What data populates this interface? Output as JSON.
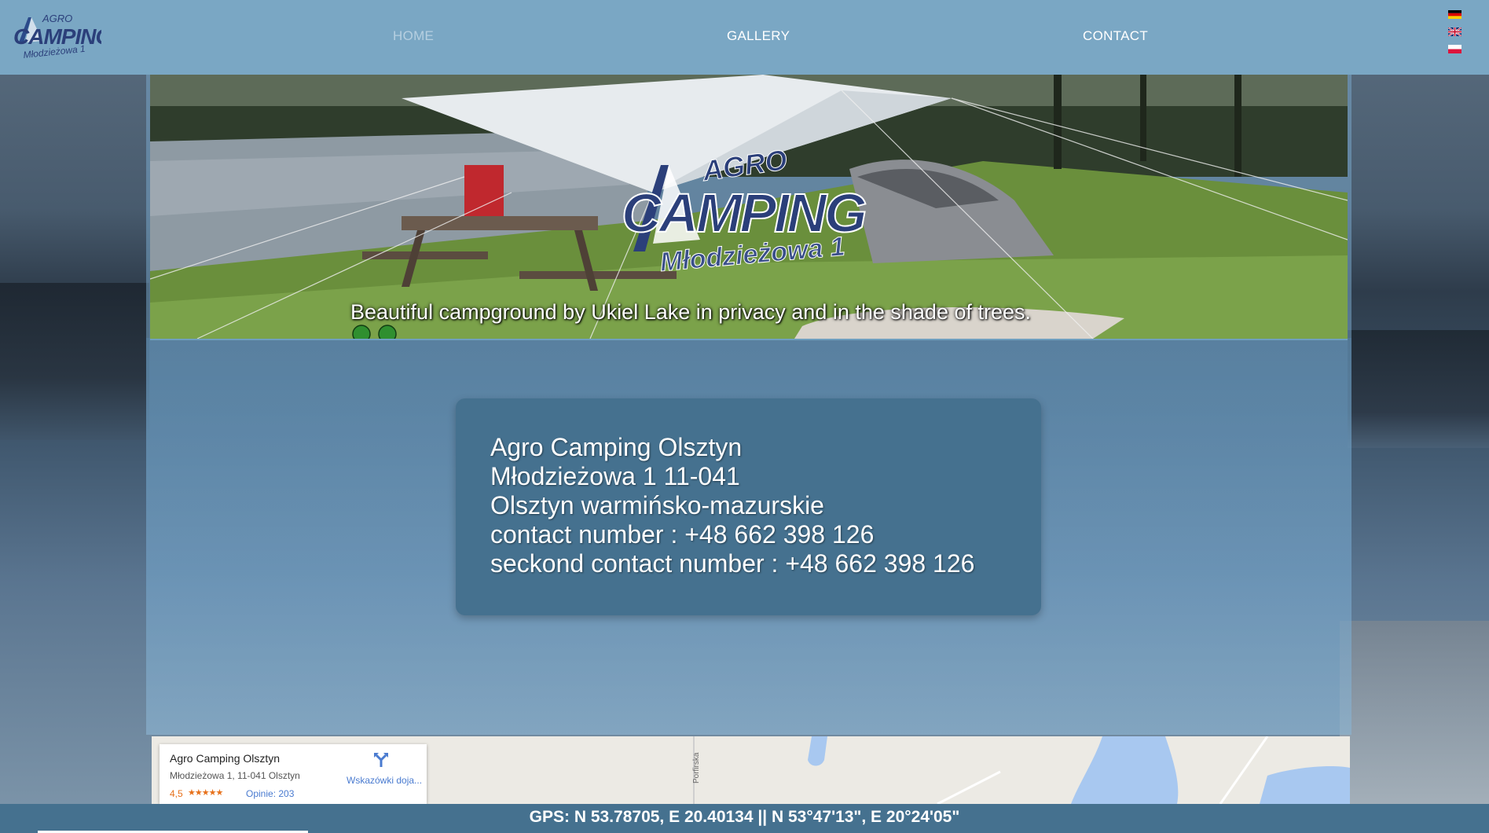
{
  "header": {
    "logo": {
      "top": "AGRO",
      "main": "CAMPING",
      "sub": "Młodzieżowa 1"
    },
    "nav": [
      {
        "label": "HOME",
        "active": true
      },
      {
        "label": "GALLERY",
        "active": false
      },
      {
        "label": "CONTACT",
        "active": false
      }
    ],
    "languages": [
      "de",
      "en",
      "pl"
    ]
  },
  "banner": {
    "logo": {
      "top": "AGRO",
      "main": "CAMPING",
      "sub": "Młodzieżowa 1"
    },
    "caption": "Beautiful campground by Ukiel Lake in privacy and in the shade of trees."
  },
  "contact": {
    "lines": [
      "Agro Camping Olsztyn",
      "Młodzieżowa 1 11-041",
      "Olsztyn warmińsko-mazurskie",
      "contact number : +48 662 398 126",
      "seckond contact number : +48 662 398 126"
    ]
  },
  "map": {
    "place_name": "Agro Camping Olsztyn",
    "address": "Młodzieżowa 1, 11-041 Olsztyn",
    "rating": "4,5",
    "stars": "★★★★★",
    "reviews": "Opinie: 203",
    "directions": "Wskazówki doja...",
    "street": "Porfirska"
  },
  "footer": {
    "gps": "GPS: N 53.78705, E 20.40134 || N 53°47'13\", E 20°24'05\""
  },
  "colors": {
    "header": "#7aa7c4",
    "card": "#45718f",
    "footer": "#45718f"
  }
}
